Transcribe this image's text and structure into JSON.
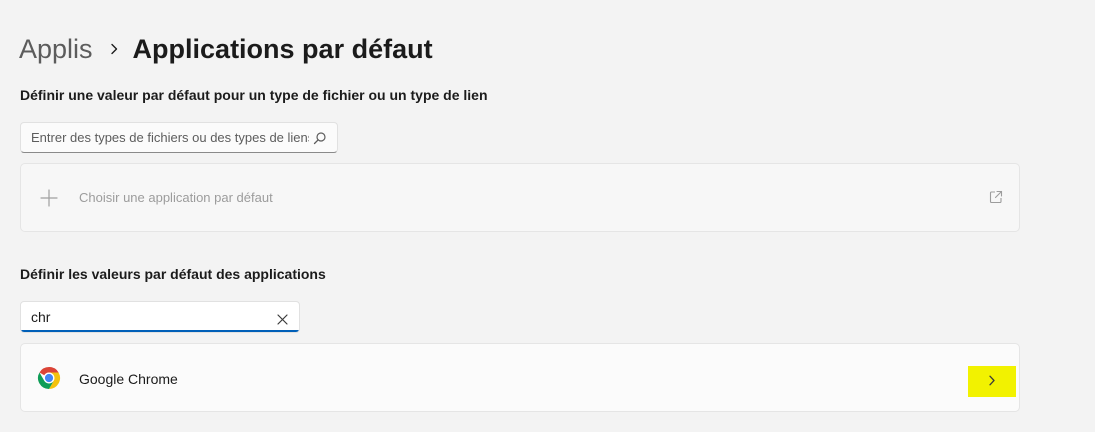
{
  "breadcrumb": {
    "parent": "Applis",
    "current": "Applications par défaut"
  },
  "section_file_types": {
    "title": "Définir une valeur par défaut pour un type de fichier ou un type de lien",
    "search_placeholder": "Entrer des types de fichiers ou des types de liens"
  },
  "choose_default": {
    "label": "Choisir une application par défaut"
  },
  "section_apps": {
    "title": "Définir les valeurs par défaut des applications",
    "search_value": "chr"
  },
  "results": [
    {
      "name": "Google Chrome",
      "icon": "chrome-logo-icon"
    }
  ],
  "colors": {
    "accent": "#005fb8",
    "highlight": "#f2f200",
    "background": "#f3f3f3"
  }
}
